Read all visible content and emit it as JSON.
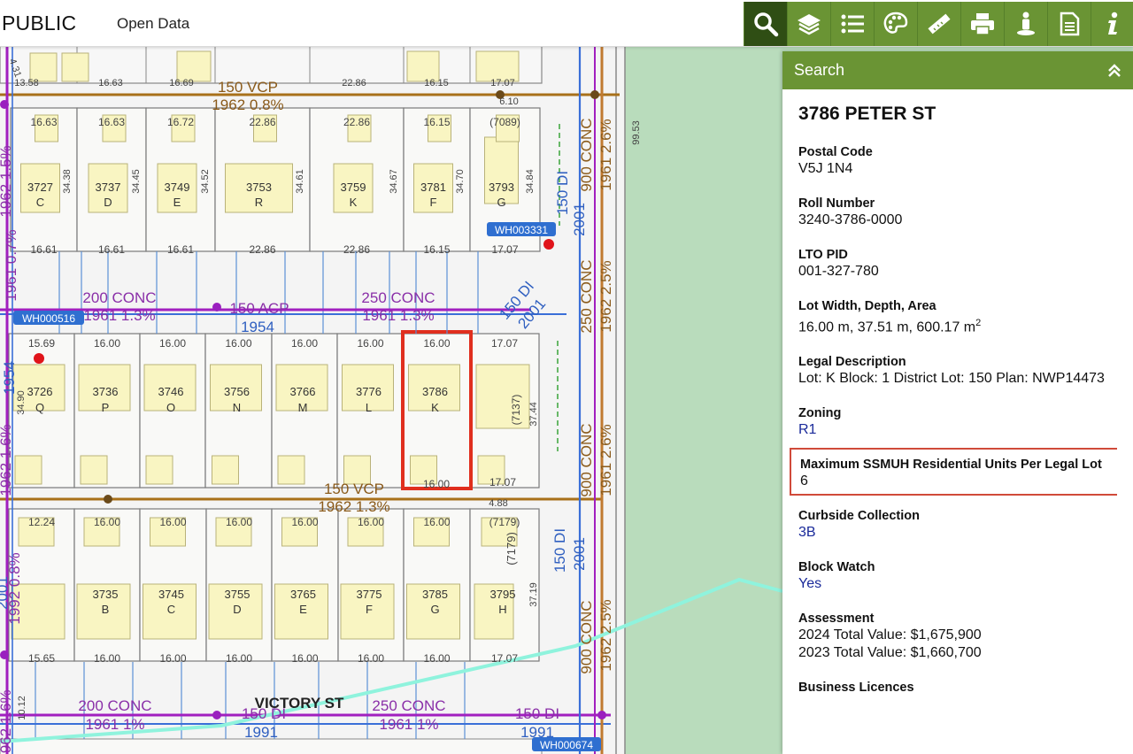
{
  "header": {
    "app_title": "PUBLIC",
    "open_data": "Open Data",
    "tools": [
      {
        "name": "search-icon",
        "active": true
      },
      {
        "name": "layers-icon"
      },
      {
        "name": "legend-icon"
      },
      {
        "name": "palette-icon"
      },
      {
        "name": "measure-icon"
      },
      {
        "name": "print-icon"
      },
      {
        "name": "streetview-icon"
      },
      {
        "name": "document-icon"
      },
      {
        "name": "info-icon"
      }
    ]
  },
  "panel": {
    "title": "Search",
    "address": "3786 PETER ST",
    "fields": {
      "postal_code": {
        "label": "Postal Code",
        "value": "V5J 1N4"
      },
      "roll_number": {
        "label": "Roll Number",
        "value": "3240-3786-0000"
      },
      "lto_pid": {
        "label": "LTO PID",
        "value": "001-327-780"
      },
      "lot_size": {
        "label": "Lot Width, Depth, Area",
        "value": "16.00 m, 37.51 m, 600.17 m",
        "unit_sup": "2"
      },
      "legal": {
        "label": "Legal Description",
        "value": "Lot: K Block: 1 District Lot: 150 Plan: NWP14473"
      },
      "zoning": {
        "label": "Zoning",
        "value": "R1"
      },
      "ssmuh": {
        "label": "Maximum SSMUH Residential Units Per Legal Lot",
        "value": "6"
      },
      "curbside": {
        "label": "Curbside Collection",
        "value": "3B"
      },
      "block_watch": {
        "label": "Block Watch",
        "value": "Yes"
      },
      "assessment": {
        "label": "Assessment",
        "line1": "2024 Total Value: $1,675,900",
        "line2": "2023 Total Value: $1,660,700"
      },
      "business": {
        "label": "Business Licences"
      }
    }
  },
  "map": {
    "row1_top_widths": [
      "13.58",
      "16.63",
      "16.69",
      "22.86",
      "16.15",
      "17.07"
    ],
    "row1_lots": [
      {
        "num": "3727",
        "letter": "C",
        "top": "16.63",
        "bottom": "16.61"
      },
      {
        "num": "3737",
        "letter": "D",
        "top": "16.63",
        "bottom": "16.61"
      },
      {
        "num": "3749",
        "letter": "E",
        "top": "16.72",
        "bottom": "16.61"
      },
      {
        "num": "3753",
        "letter": "R",
        "top": "22.86",
        "bottom": "22.86"
      },
      {
        "num": "3759",
        "letter": "K",
        "top": "22.86",
        "bottom": "22.86"
      },
      {
        "num": "3781",
        "letter": "F",
        "top": "16.15",
        "bottom": "16.15"
      },
      {
        "num": "3793",
        "letter": "G",
        "top": "(7089)",
        "bottom": "17.07"
      }
    ],
    "row1_depths": [
      "34.38",
      "34.45",
      "34.52",
      "34.61",
      "34.67",
      "34.70",
      "34.84"
    ],
    "row2_lots": [
      {
        "num": "3726",
        "letter": "Q",
        "top": "15.69"
      },
      {
        "num": "3736",
        "letter": "P",
        "top": "16.00"
      },
      {
        "num": "3746",
        "letter": "O",
        "top": "16.00"
      },
      {
        "num": "3756",
        "letter": "N",
        "top": "16.00"
      },
      {
        "num": "3766",
        "letter": "M",
        "top": "16.00"
      },
      {
        "num": "3776",
        "letter": "L",
        "top": "16.00"
      },
      {
        "num": "3786",
        "letter": "K",
        "top": "16.00"
      },
      {
        "num": "",
        "letter": "",
        "top": "17.07"
      }
    ],
    "row2_extra": {
      "plan": "(7137)",
      "depth": "37.44",
      "left_depth": "34.90",
      "bottom": "16.00",
      "bottom_right": "17.07",
      "street_dim": "4.88"
    },
    "row3_lots": [
      {
        "num": "",
        "letter": "",
        "top": "12.24",
        "bottom": "15.65"
      },
      {
        "num": "3735",
        "letter": "B",
        "top": "16.00",
        "bottom": "16.00"
      },
      {
        "num": "3745",
        "letter": "C",
        "top": "16.00",
        "bottom": "16.00"
      },
      {
        "num": "3755",
        "letter": "D",
        "top": "16.00",
        "bottom": "16.00"
      },
      {
        "num": "3765",
        "letter": "E",
        "top": "16.00",
        "bottom": "16.00"
      },
      {
        "num": "3775",
        "letter": "F",
        "top": "16.00",
        "bottom": "16.00"
      },
      {
        "num": "3785",
        "letter": "G",
        "top": "16.00",
        "bottom": "16.00"
      },
      {
        "num": "3795",
        "letter": "H",
        "top": "(7179)",
        "bottom": "17.07"
      }
    ],
    "row3_extra": {
      "depth": "37.19"
    },
    "labels": {
      "vcp_top": "150 VCP",
      "vcp_top_year": "1962 0.8%",
      "top_right_dim": "6.10",
      "conc900": "900 CONC",
      "conc900_year": "1961 2.6%",
      "conc900_b": "900 CONC",
      "conc900_b_year": "1961 2.6%",
      "di150_v": "150 DI",
      "year2001": "2001",
      "year_left_1962": "1962 1.5%",
      "year_left_1961": "1961 0.7%",
      "wh003331": "WH003331",
      "wh000516": "WH000516",
      "wh000674": "WH000674",
      "conc200": "200 CONC",
      "conc200_year": "1961 1.3%",
      "acp150": "150 ACP",
      "year1954": "1954",
      "conc250": "250 CONC",
      "conc250_year": "1961 1.3%",
      "di150_diag": "150 DI",
      "year2001_diag": "2001",
      "conc250_v": "250 CONC",
      "conc250_v_year": "1962 2.5%",
      "vcp_mid": "150 VCP",
      "vcp_mid_year": "1962 1.3%",
      "left_1954": "1954",
      "left_1962": "1962 1.6%",
      "left_1992": "1992 0.8%",
      "left_2001": "2001",
      "di150_v2": "150 DI",
      "year2001_v2": "2001",
      "conc250_v2": "250 CONC",
      "conc250_v2_year": "1962 2.5%",
      "street": "VICTORY ST",
      "conc200_b": "200 CONC",
      "conc200_b_year": "1961 1%",
      "di150_b": "150 DI",
      "year1991_b": "1991",
      "conc250_b": "250 CONC",
      "conc250_b_year": "1961 1%",
      "di150_c": "150 DI",
      "year1991_c": "1991",
      "left_1962_b": "1962 1.6%",
      "elev": "99.53",
      "left_431": "4.31",
      "left_1012": "10.12"
    }
  }
}
